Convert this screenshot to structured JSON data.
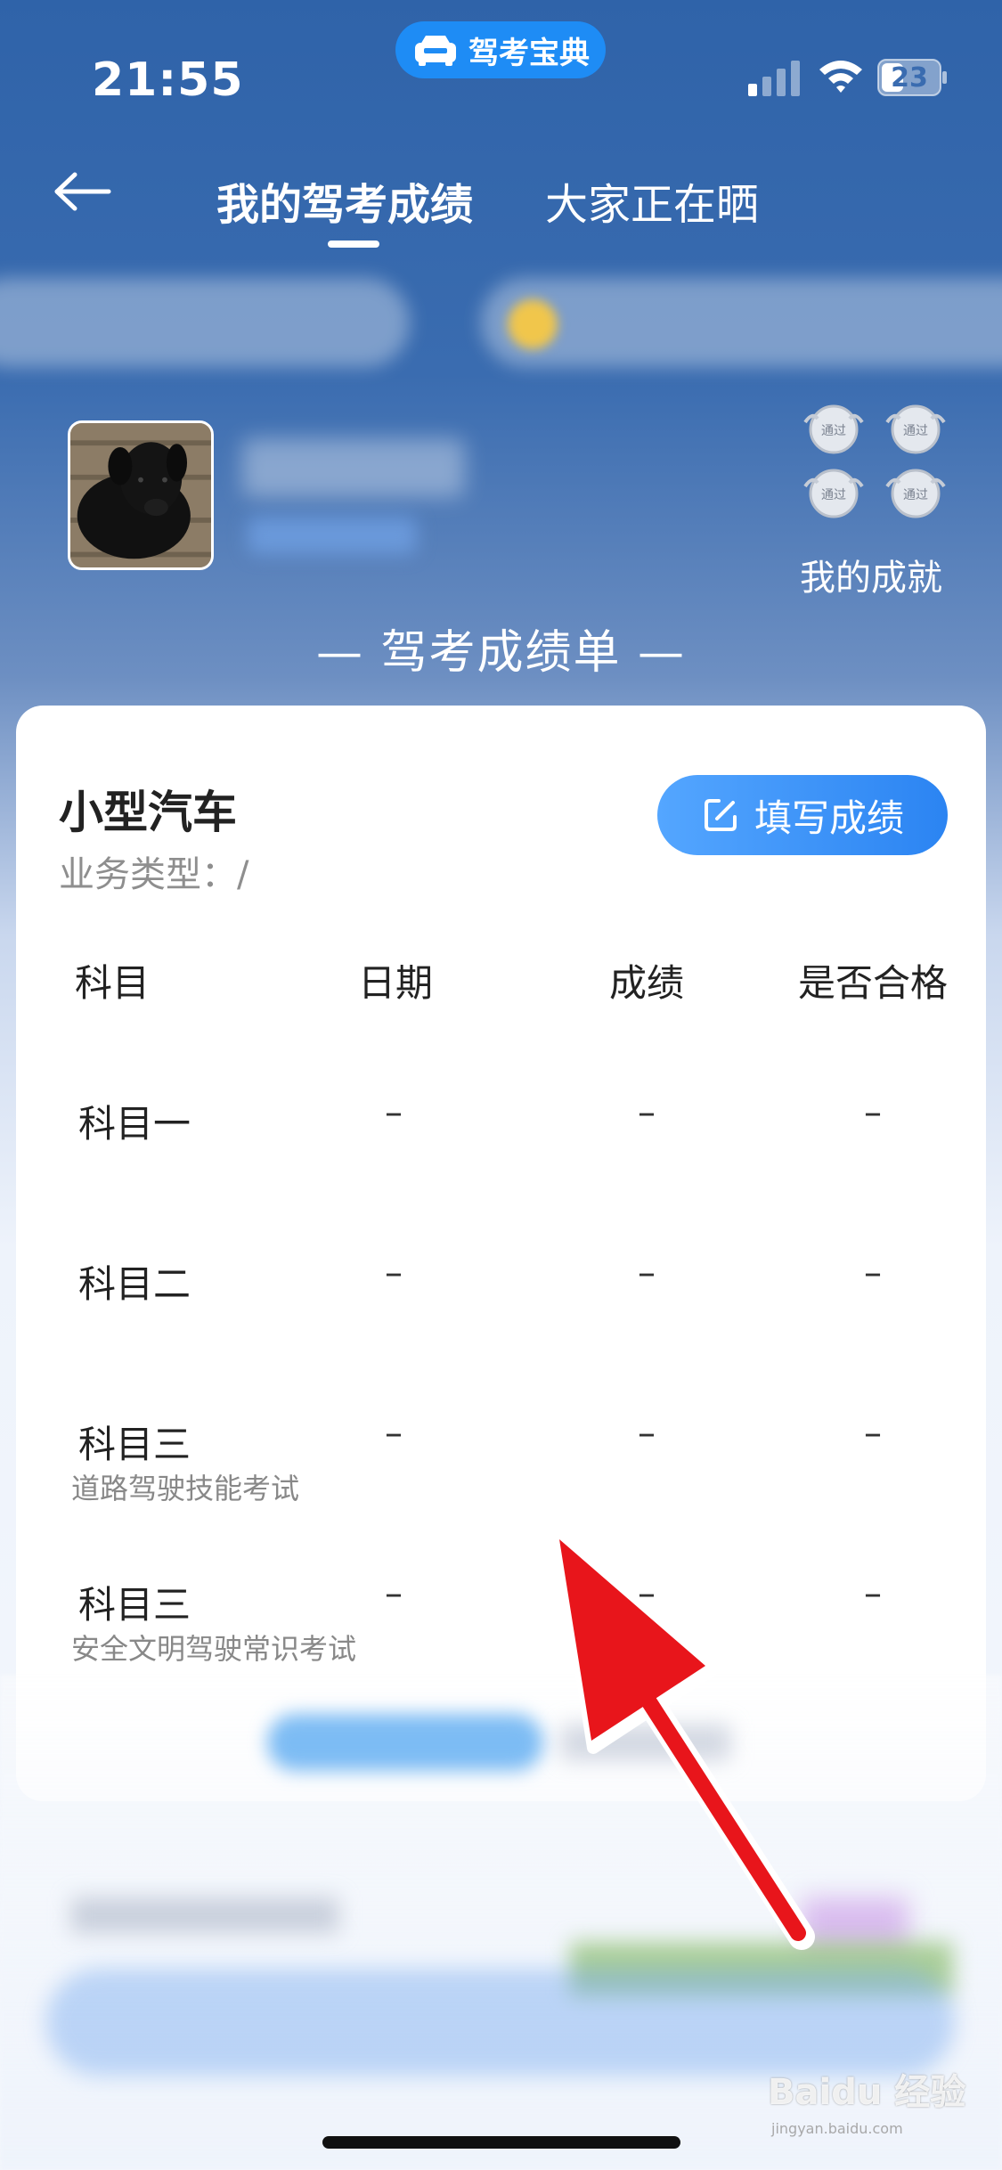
{
  "status_bar": {
    "time": "21:55",
    "battery": "23"
  },
  "app_pill": {
    "name": "驾考宝典"
  },
  "nav": {
    "tab_mine": "我的驾考成绩",
    "tab_others": "大家正在晒"
  },
  "profile": {
    "achievements_label": "我的成就",
    "badge_text": "通过"
  },
  "report": {
    "title": "— 驾考成绩单 —"
  },
  "card": {
    "car_type": "小型汽车",
    "business_type": "业务类型：/",
    "fill_button": "填写成绩",
    "headers": [
      "科目",
      "日期",
      "成绩",
      "是否合格"
    ],
    "rows": [
      {
        "subject": "科目一",
        "note": "",
        "date": "–",
        "score": "–",
        "passed": "–"
      },
      {
        "subject": "科目二",
        "note": "",
        "date": "–",
        "score": "–",
        "passed": "–"
      },
      {
        "subject": "科目三",
        "note": "道路驾驶技能考试",
        "date": "–",
        "score": "–",
        "passed": "–"
      },
      {
        "subject": "科目三",
        "note": "安全文明驾驶常识考试",
        "date": "–",
        "score": "–",
        "passed": "–"
      }
    ]
  },
  "watermark": {
    "text": "Baidu 经验",
    "sub": "jingyan.baidu.com"
  },
  "colors": {
    "accent": "#2b84f2",
    "header_bg": "#3a6cb0",
    "arrow": "#e8151b"
  }
}
